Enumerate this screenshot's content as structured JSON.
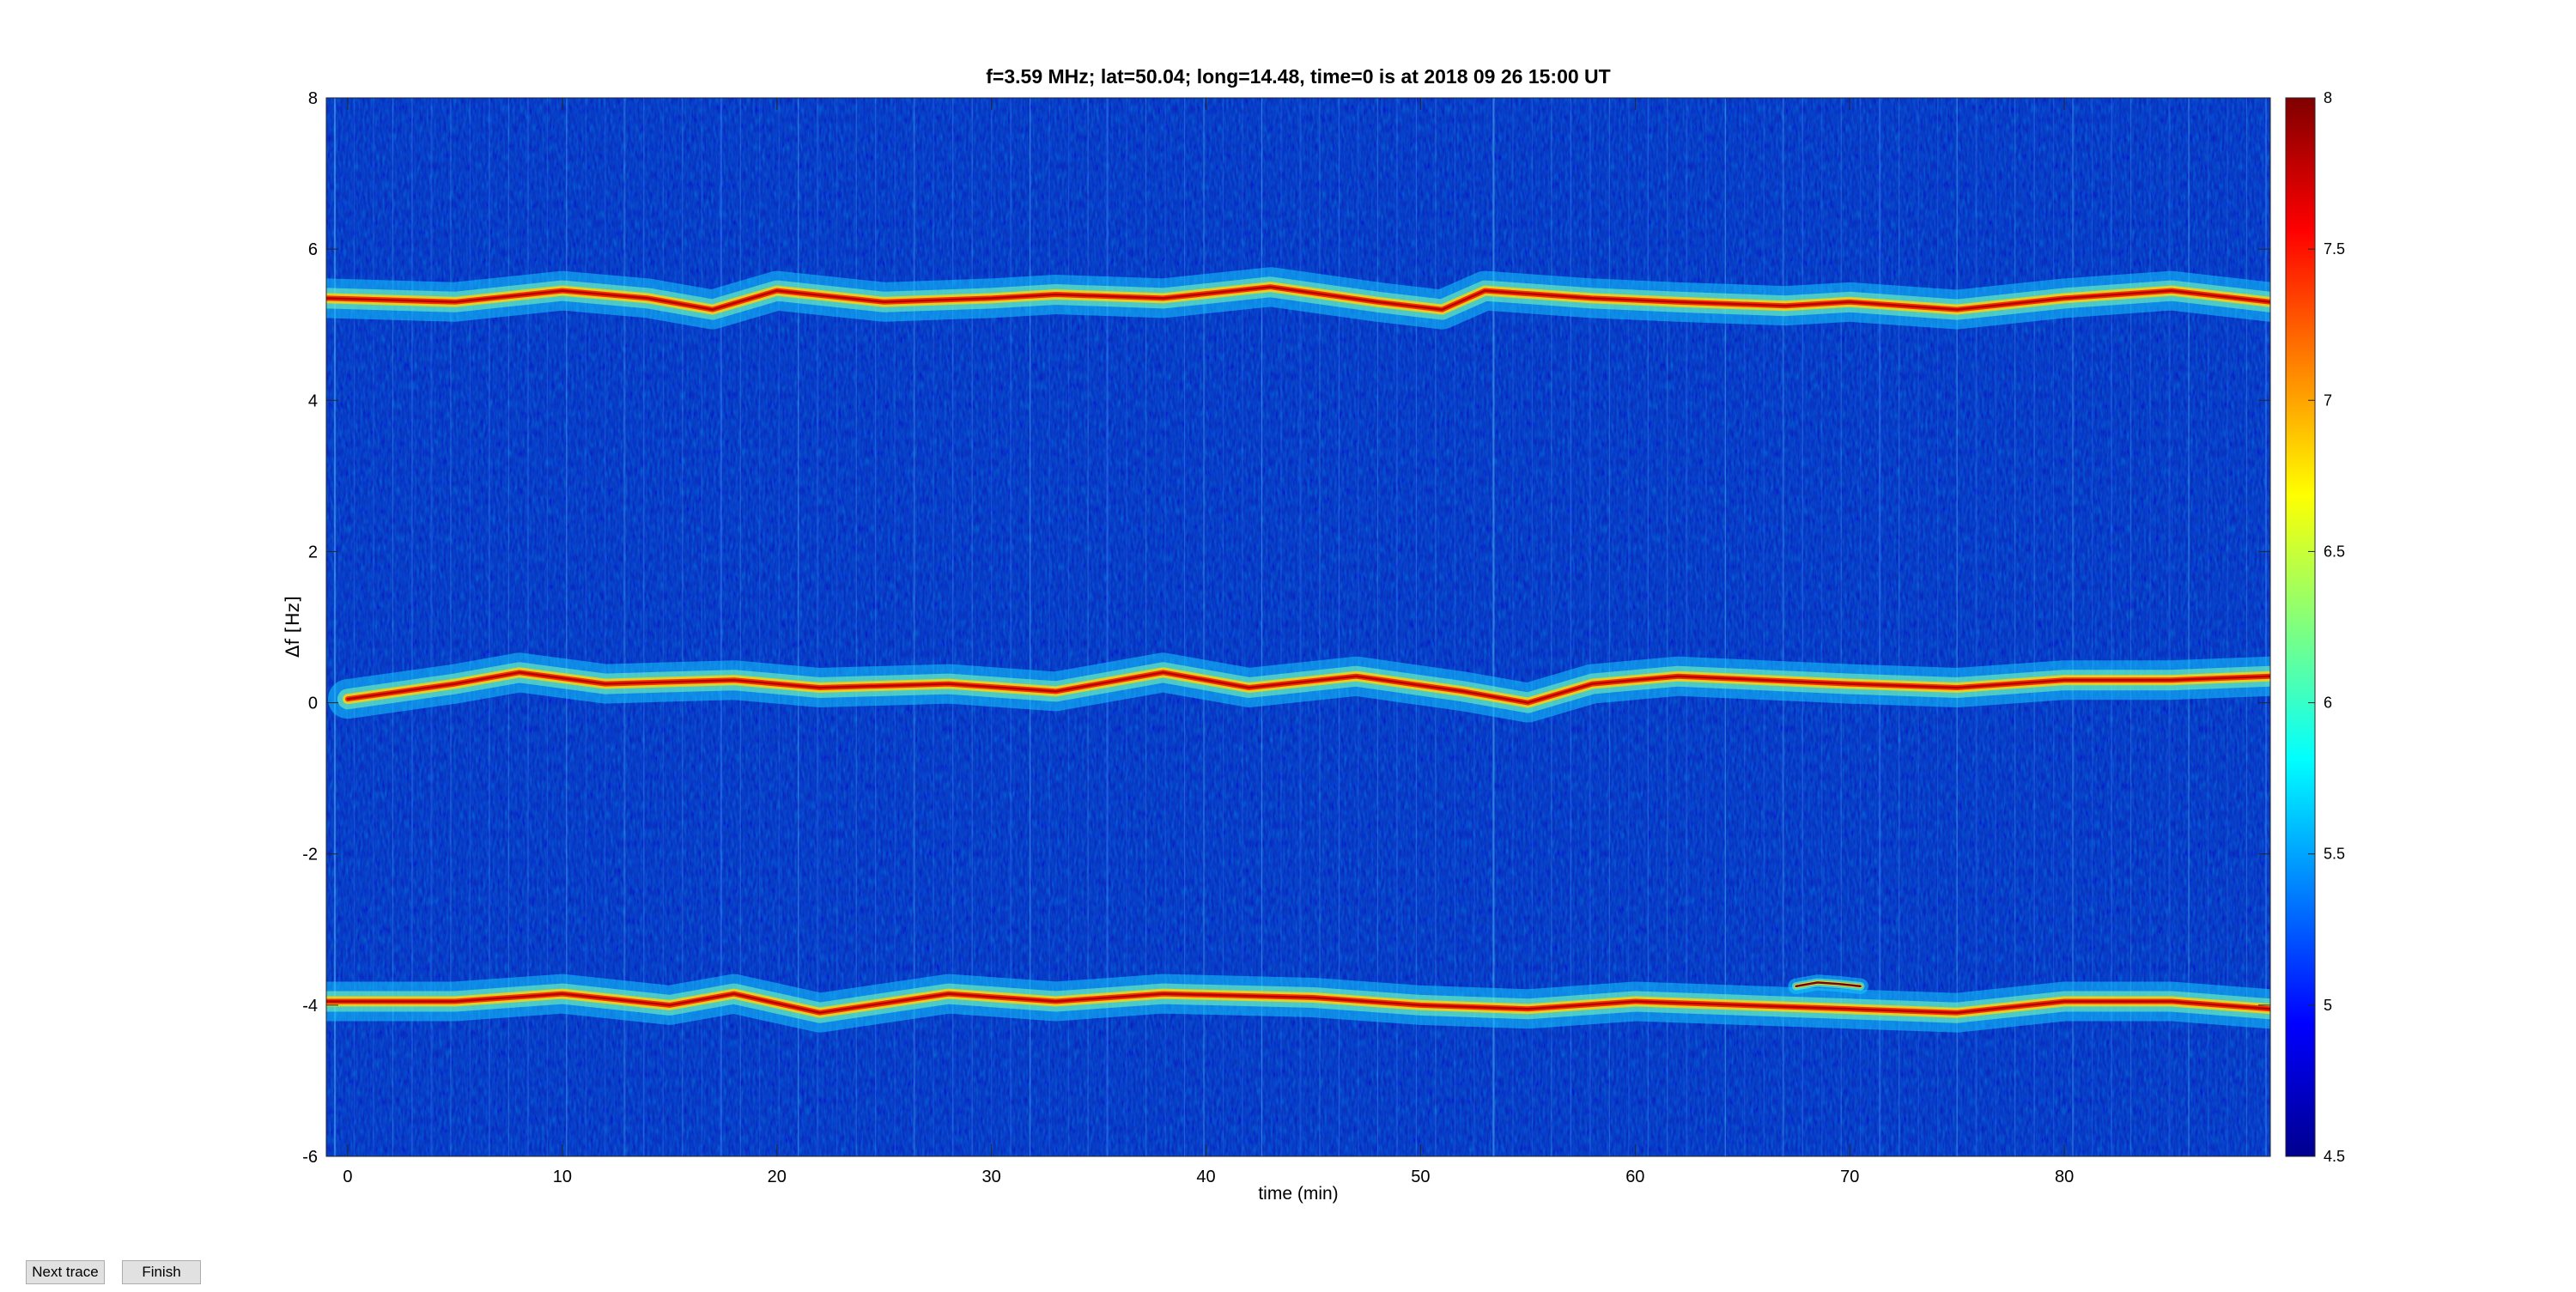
{
  "toolbar": {
    "next_label": "Next trace",
    "finish_label": "Finish"
  },
  "chart_data": {
    "type": "heatmap",
    "title": "f=3.59 MHz;  lat=50.04; long=14.48, time=0 is at 2018 09 26 15:00 UT",
    "xlabel": "time (min)",
    "ylabel": "Δf [Hz]",
    "xlim": [
      -1,
      89.6
    ],
    "ylim": [
      -6,
      8
    ],
    "xticks": [
      0,
      10,
      20,
      30,
      40,
      50,
      60,
      70,
      80
    ],
    "yticks": [
      -6,
      -4,
      -2,
      0,
      2,
      4,
      6,
      8
    ],
    "colorbar": {
      "min": 4.5,
      "max": 8,
      "ticks": [
        4.5,
        5,
        5.5,
        6,
        6.5,
        7,
        7.5,
        8
      ],
      "colormap": "jet"
    },
    "traces": [
      {
        "t": [
          0,
          5,
          8,
          12,
          18,
          22,
          28,
          33,
          38,
          42,
          47,
          52,
          55,
          58,
          62,
          66,
          70,
          75,
          80,
          85,
          89.6
        ],
        "df": [
          0.05,
          0.25,
          0.4,
          0.25,
          0.3,
          0.2,
          0.25,
          0.15,
          0.4,
          0.2,
          0.35,
          0.15,
          0.0,
          0.25,
          0.35,
          0.3,
          0.25,
          0.2,
          0.3,
          0.3,
          0.35
        ]
      },
      {
        "t": [
          -1,
          5,
          10,
          14,
          17,
          20,
          25,
          30,
          33,
          38,
          43,
          48,
          51,
          53,
          58,
          62,
          67,
          70,
          75,
          80,
          85,
          89.6
        ],
        "df": [
          5.35,
          5.3,
          5.45,
          5.35,
          5.2,
          5.45,
          5.3,
          5.35,
          5.4,
          5.35,
          5.5,
          5.3,
          5.2,
          5.45,
          5.35,
          5.3,
          5.25,
          5.3,
          5.2,
          5.35,
          5.45,
          5.3
        ]
      },
      {
        "t": [
          -1,
          5,
          10,
          15,
          18,
          22,
          28,
          33,
          38,
          45,
          50,
          55,
          60,
          65,
          70,
          75,
          80,
          85,
          89.6
        ],
        "df": [
          -3.95,
          -3.95,
          -3.85,
          -4.0,
          -3.85,
          -4.1,
          -3.85,
          -3.95,
          -3.85,
          -3.9,
          -4.0,
          -4.05,
          -3.95,
          -4.0,
          -4.05,
          -4.1,
          -3.95,
          -3.95,
          -4.05
        ]
      },
      {
        "t": [
          67.5,
          68.5,
          69.5,
          70.5
        ],
        "df": [
          -3.75,
          -3.7,
          -3.72,
          -3.75
        ]
      }
    ]
  }
}
